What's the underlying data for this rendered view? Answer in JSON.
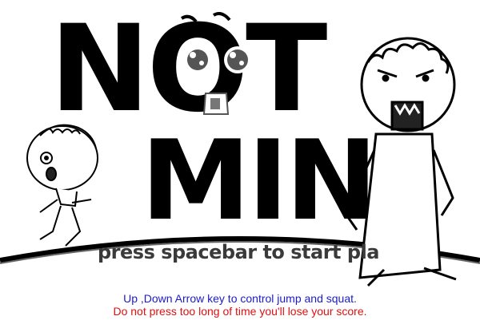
{
  "title": {
    "line1": "NOT",
    "line2": "MINI"
  },
  "start_prompt": "press spacebar to start pla",
  "instructions": {
    "controls": "Up ,Down Arrow key to control jump and squat.",
    "warning": "Do not press too long of time you'll lose your score."
  },
  "colors": {
    "controls_text": "#1a1ad0",
    "warning_text": "#e01010",
    "ink": "#000000",
    "background": "#ffffff"
  }
}
